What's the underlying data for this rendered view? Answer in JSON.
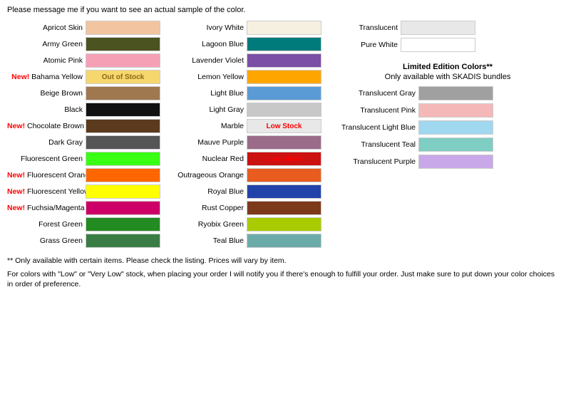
{
  "header": {
    "text": "Please message me if you want to see an actual sample of the color."
  },
  "column1": {
    "items": [
      {
        "name": "Apricot Skin",
        "new": false,
        "color": "#F2C5A0",
        "status": ""
      },
      {
        "name": "Army Green",
        "new": false,
        "color": "#4B5320",
        "status": ""
      },
      {
        "name": "Atomic Pink",
        "new": false,
        "color": "#F5A0B5",
        "status": ""
      },
      {
        "name": "Bahama Yellow",
        "new": true,
        "color": "#F5D76E",
        "status": "out_of_stock"
      },
      {
        "name": "Beige Brown",
        "new": false,
        "color": "#A07850",
        "status": ""
      },
      {
        "name": "Black",
        "new": false,
        "color": "#111111",
        "status": ""
      },
      {
        "name": "Chocolate Brown",
        "new": true,
        "color": "#5C3A1E",
        "status": ""
      },
      {
        "name": "Dark Gray",
        "new": false,
        "color": "#555555",
        "status": ""
      },
      {
        "name": "Fluorescent Green",
        "new": false,
        "color": "#39FF14",
        "status": ""
      },
      {
        "name": "Fluorescent Orange",
        "new": true,
        "color": "#FF6600",
        "status": ""
      },
      {
        "name": "Fluorescent Yellow",
        "new": true,
        "color": "#FFFF00",
        "status": ""
      },
      {
        "name": "Fuchsia/Magenta",
        "new": true,
        "color": "#CC0066",
        "status": ""
      },
      {
        "name": "Forest Green",
        "new": false,
        "color": "#228B22",
        "status": ""
      },
      {
        "name": "Grass Green",
        "new": false,
        "color": "#3A7D44",
        "status": ""
      }
    ]
  },
  "column2": {
    "items": [
      {
        "name": "Ivory White",
        "new": false,
        "color": "#F5F0E0",
        "status": ""
      },
      {
        "name": "Lagoon Blue",
        "new": false,
        "color": "#007B7B",
        "status": ""
      },
      {
        "name": "Lavender Violet",
        "new": false,
        "color": "#7B4FA6",
        "status": ""
      },
      {
        "name": "Lemon Yellow",
        "new": false,
        "color": "#FFA500",
        "status": ""
      },
      {
        "name": "Light Blue",
        "new": false,
        "color": "#5B9BD5",
        "status": ""
      },
      {
        "name": "Light Gray",
        "new": false,
        "color": "#C8C8C8",
        "status": ""
      },
      {
        "name": "Marble",
        "new": false,
        "color": "#E8E8E8",
        "status": "low_stock"
      },
      {
        "name": "Mauve Purple",
        "new": false,
        "color": "#9B6B8A",
        "status": ""
      },
      {
        "name": "Nuclear Red",
        "new": false,
        "color": "#CC1111",
        "status": "low_stock"
      },
      {
        "name": "Outrageous Orange",
        "new": false,
        "color": "#E85C20",
        "status": ""
      },
      {
        "name": "Royal Blue",
        "new": false,
        "color": "#2244AA",
        "status": ""
      },
      {
        "name": "Rust Copper",
        "new": false,
        "color": "#7D3A1A",
        "status": ""
      },
      {
        "name": "Ryobix Green",
        "new": false,
        "color": "#A8CC00",
        "status": ""
      },
      {
        "name": "Teal Blue",
        "new": false,
        "color": "#6AABAA",
        "status": ""
      }
    ]
  },
  "basic_swatches": {
    "items": [
      {
        "name": "Translucent",
        "color": "#E8E8E8"
      },
      {
        "name": "Pure White",
        "color": "#FFFFFF"
      }
    ]
  },
  "limited": {
    "title": "Limited Edition Colors**",
    "subtitle": "Only available with SKADIS bundles",
    "items": [
      {
        "name": "Translucent Gray",
        "color": "#A0A0A0"
      },
      {
        "name": "Translucent Pink",
        "color": "#F5B8B8"
      },
      {
        "name": "Translucent Light Blue",
        "color": "#A0D8EF"
      },
      {
        "name": "Translucent Teal",
        "color": "#7ECEC4"
      },
      {
        "name": "Translucent Purple",
        "color": "#C8A8E8"
      }
    ]
  },
  "footer": {
    "line1": "** Only available with certain items. Please check the listing. Prices will vary by item.",
    "line2": "For colors with \"Low\" or \"Very Low\" stock, when placing your order I will notify you if there's enough to fulfill your order. Just make sure to put down your color choices in order of preference."
  },
  "labels": {
    "out_of_stock": "Out of Stock",
    "low_stock": "Low Stock"
  }
}
